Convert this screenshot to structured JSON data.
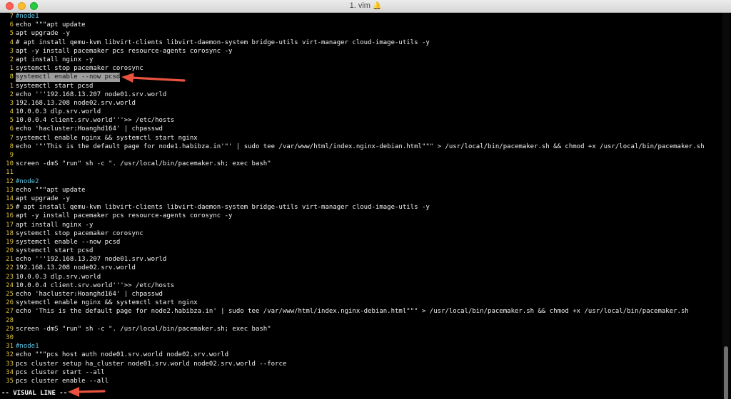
{
  "window": {
    "title": "1. vim",
    "bell_glyph": "🔔"
  },
  "editor": {
    "lines": [
      {
        "num": "7",
        "text": "#node1",
        "kind": "comment"
      },
      {
        "num": "6",
        "text": "echo \"\"\"apt update",
        "kind": "code"
      },
      {
        "num": "5",
        "text": "apt upgrade -y",
        "kind": "code"
      },
      {
        "num": "4",
        "text": "# apt install qemu-kvm libvirt-clients libvirt-daemon-system bridge-utils virt-manager cloud-image-utils -y",
        "kind": "code"
      },
      {
        "num": "3",
        "text": "apt -y install pacemaker pcs resource-agents corosync -y",
        "kind": "code"
      },
      {
        "num": "2",
        "text": "apt install nginx -y",
        "kind": "code"
      },
      {
        "num": "1",
        "text": "systemctl stop pacemaker corosync",
        "kind": "code"
      },
      {
        "num": "8",
        "text": "systemctl enable --now pcsd",
        "kind": "selected"
      },
      {
        "num": "1",
        "text": "systemctl start pcsd",
        "kind": "code"
      },
      {
        "num": "2",
        "text": "echo '''192.168.13.207 node01.srv.world",
        "kind": "code"
      },
      {
        "num": "3",
        "text": "192.168.13.208 node02.srv.world",
        "kind": "code"
      },
      {
        "num": "4",
        "text": "10.0.0.3 dlp.srv.world",
        "kind": "code"
      },
      {
        "num": "5",
        "text": "10.0.0.4 client.srv.world'''>> /etc/hosts",
        "kind": "code"
      },
      {
        "num": "6",
        "text": "echo 'hacluster:Hoanghd164' | chpasswd",
        "kind": "code"
      },
      {
        "num": "7",
        "text": "systemctl enable nginx && systemctl start nginx",
        "kind": "code"
      },
      {
        "num": "8",
        "text": "echo '\"'This is the default page for node1.habibza.in'\"' | sudo tee /var/www/html/index.nginx-debian.html\"\"\" > /usr/local/bin/pacemaker.sh && chmod +x /usr/local/bin/pacemaker.sh",
        "kind": "code"
      },
      {
        "num": "9",
        "text": "",
        "kind": "code"
      },
      {
        "num": "10",
        "text": "screen -dmS \"run\" sh -c \". /usr/local/bin/pacemaker.sh; exec bash\"",
        "kind": "code"
      },
      {
        "num": "11",
        "text": "",
        "kind": "code"
      },
      {
        "num": "12",
        "text": "#node2",
        "kind": "comment"
      },
      {
        "num": "13",
        "text": "echo \"\"\"apt update",
        "kind": "code"
      },
      {
        "num": "14",
        "text": "apt upgrade -y",
        "kind": "code"
      },
      {
        "num": "15",
        "text": "# apt install qemu-kvm libvirt-clients libvirt-daemon-system bridge-utils virt-manager cloud-image-utils -y",
        "kind": "code"
      },
      {
        "num": "16",
        "text": "apt -y install pacemaker pcs resource-agents corosync -y",
        "kind": "code"
      },
      {
        "num": "17",
        "text": "apt install nginx -y",
        "kind": "code"
      },
      {
        "num": "18",
        "text": "systemctl stop pacemaker corosync",
        "kind": "code"
      },
      {
        "num": "19",
        "text": "systemctl enable --now pcsd",
        "kind": "code"
      },
      {
        "num": "20",
        "text": "systemctl start pcsd",
        "kind": "code"
      },
      {
        "num": "21",
        "text": "echo '''192.168.13.207 node01.srv.world",
        "kind": "code"
      },
      {
        "num": "22",
        "text": "192.168.13.208 node02.srv.world",
        "kind": "code"
      },
      {
        "num": "23",
        "text": "10.0.0.3 dlp.srv.world",
        "kind": "code"
      },
      {
        "num": "24",
        "text": "10.0.0.4 client.srv.world'''>> /etc/hosts",
        "kind": "code"
      },
      {
        "num": "25",
        "text": "echo 'hacluster:Hoanghd164' | chpasswd",
        "kind": "code"
      },
      {
        "num": "26",
        "text": "systemctl enable nginx && systemctl start nginx",
        "kind": "code"
      },
      {
        "num": "27",
        "text": "echo 'This is the default page for node2.habibza.in' | sudo tee /var/www/html/index.nginx-debian.html\"\"\" > /usr/local/bin/pacemaker.sh && chmod +x /usr/local/bin/pacemaker.sh",
        "kind": "code"
      },
      {
        "num": "28",
        "text": "",
        "kind": "code"
      },
      {
        "num": "29",
        "text": "screen -dmS \"run\" sh -c \". /usr/local/bin/pacemaker.sh; exec bash\"",
        "kind": "code"
      },
      {
        "num": "30",
        "text": "",
        "kind": "code"
      },
      {
        "num": "31",
        "text": "#node1",
        "kind": "comment"
      },
      {
        "num": "32",
        "text": "echo \"\"\"pcs host auth node01.srv.world node02.srv.world",
        "kind": "code"
      },
      {
        "num": "33",
        "text": "pcs cluster setup ha_cluster node01.srv.world node02.srv.world --force",
        "kind": "code"
      },
      {
        "num": "34",
        "text": "pcs cluster start --all",
        "kind": "code"
      },
      {
        "num": "35",
        "text": "pcs cluster enable --all",
        "kind": "code"
      }
    ]
  },
  "status": {
    "mode": "-- VISUAL LINE --"
  },
  "colors": {
    "line_number": "#e2c341",
    "comment": "#5ec8e8",
    "selection": "#9d9d9d",
    "arrow": "#e8523f"
  }
}
